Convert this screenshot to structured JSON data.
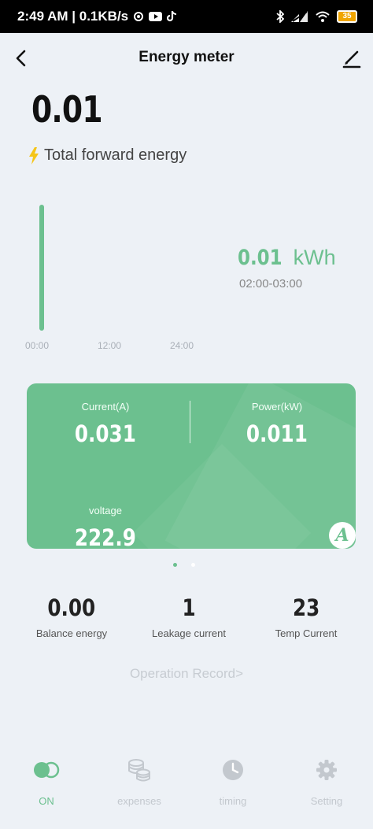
{
  "status_bar": {
    "time_speed": "2:49 AM | 0.1KB/s",
    "battery": "35"
  },
  "header": {
    "title": "Energy meter"
  },
  "main": {
    "total_value": "0.01",
    "total_label": "Total forward energy"
  },
  "chart_data": {
    "type": "bar",
    "x_ticks": [
      "00:00",
      "12:00",
      "24:00"
    ],
    "values": [
      0.01
    ],
    "selected_value": "0.01",
    "selected_unit": "kWh",
    "selected_range": "02:00-03:00",
    "accent": "#6cc08f"
  },
  "card": {
    "current_label": "Current(A)",
    "current_value": "0.031",
    "power_label": "Power(kW)",
    "power_value": "0.011",
    "voltage_label": "voltage",
    "voltage_value": "222.9",
    "badge": "A"
  },
  "stats": [
    {
      "value": "0.00",
      "label": "Balance energy"
    },
    {
      "value": "1",
      "label": "Leakage current"
    },
    {
      "value": "23",
      "label": "Temp Current"
    }
  ],
  "operation_record": "Operation Record>",
  "nav": [
    {
      "label": "ON",
      "icon": "toggle-icon",
      "active": true
    },
    {
      "label": "expenses",
      "icon": "coins-icon",
      "active": false
    },
    {
      "label": "timing",
      "icon": "clock-icon",
      "active": false
    },
    {
      "label": "Setting",
      "icon": "gear-icon",
      "active": false
    }
  ],
  "colors": {
    "accent": "#6cc08f",
    "background": "#edf1f6",
    "inactive": "#c3c8ce"
  }
}
